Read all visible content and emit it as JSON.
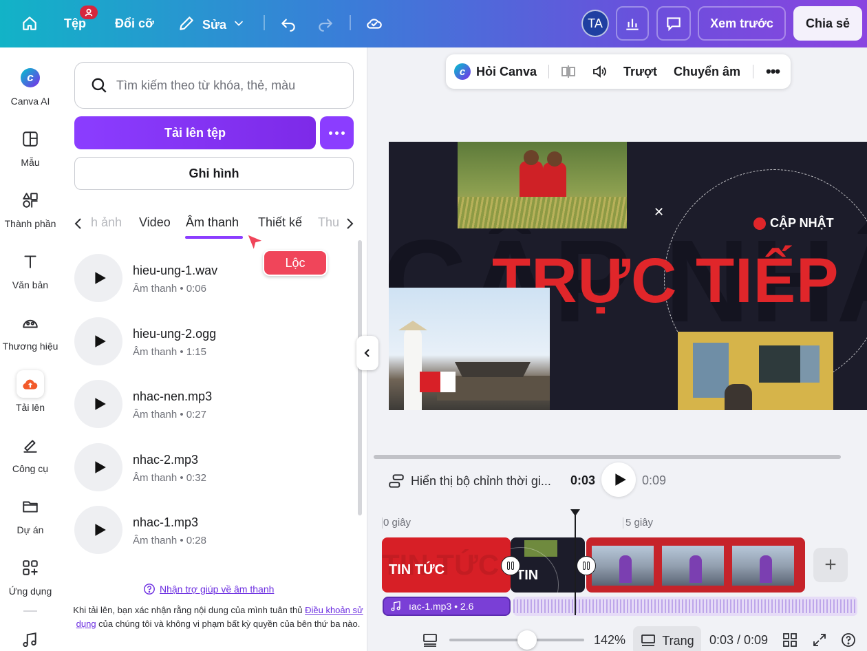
{
  "topbar": {
    "home_icon": "home-icon",
    "file_label": "Tệp",
    "resize_label": "Đổi cỡ",
    "edit_label": "Sửa",
    "avatar_initials": "TA",
    "preview_label": "Xem trước",
    "share_label": "Chia sẻ"
  },
  "rail": {
    "items": [
      {
        "label": "Canva AI",
        "icon": "canva-ai-icon"
      },
      {
        "label": "Mẫu",
        "icon": "template-icon"
      },
      {
        "label": "Thành phần",
        "icon": "elements-icon"
      },
      {
        "label": "Văn bản",
        "icon": "text-icon"
      },
      {
        "label": "Thương hiệu",
        "icon": "brand-icon"
      },
      {
        "label": "Tải lên",
        "icon": "upload-cloud-icon"
      },
      {
        "label": "Công cụ",
        "icon": "tools-icon"
      },
      {
        "label": "Dự án",
        "icon": "folder-icon"
      },
      {
        "label": "Ứng dụng",
        "icon": "apps-icon"
      }
    ]
  },
  "panel": {
    "search_placeholder": "Tìm kiếm theo từ khóa, thẻ, màu",
    "upload_label": "Tải lên tệp",
    "record_label": "Ghi hình",
    "tabs": [
      "h ảnh",
      "Video",
      "Âm thanh",
      "Thiết kế",
      "Thu"
    ],
    "active_tab": "Âm thanh",
    "filter_label": "Lộc",
    "files": [
      {
        "name": "hieu-ung-1.wav",
        "meta": "Âm thanh • 0:06"
      },
      {
        "name": "hieu-ung-2.ogg",
        "meta": "Âm thanh • 1:15"
      },
      {
        "name": "nhac-nen.mp3",
        "meta": "Âm thanh • 0:27"
      },
      {
        "name": "nhac-2.mp3",
        "meta": "Âm thanh • 0:32"
      },
      {
        "name": "nhac-1.mp3",
        "meta": "Âm thanh • 0:28"
      }
    ],
    "help_link": "Nhận trợ giúp về âm thanh",
    "terms_before": "Khi tải lên, bạn xác nhận rằng nội dung của mình tuân thủ ",
    "terms_link": "Điều khoản sử dụng",
    "terms_after": " của chúng tôi và không vi phạm bất kỳ quyền của bên thứ ba nào."
  },
  "context_bar": {
    "ask_canva": "Hỏi Canva",
    "slide_label": "Trượt",
    "transition_label": "Chuyển âm"
  },
  "slide": {
    "bg_text": "CẬP NHẬT",
    "headline": "TRỰC TIẾP",
    "tag": "CẬP NHẬT"
  },
  "timeline": {
    "toggle_label": "Hiển thị bộ chỉnh thời gi...",
    "current_time": "0:03",
    "duration": "0:09",
    "ruler_start": "0 giây",
    "ruler_mid": "5 giây",
    "clip1_text": "TIN TỨC",
    "clip1_bg": "TIN TỨC",
    "clip2_text": "TIN",
    "audio_label": "ıac-1.mp3 • 2.6"
  },
  "bottom": {
    "zoom": "142%",
    "zoom_fraction": 0.5,
    "page_label": "Trang",
    "time_total": "0:03 / 0:09"
  },
  "colors": {
    "accent": "#8b3dff",
    "headline_red": "#e0262a",
    "filter_badge": "#f0455a"
  }
}
